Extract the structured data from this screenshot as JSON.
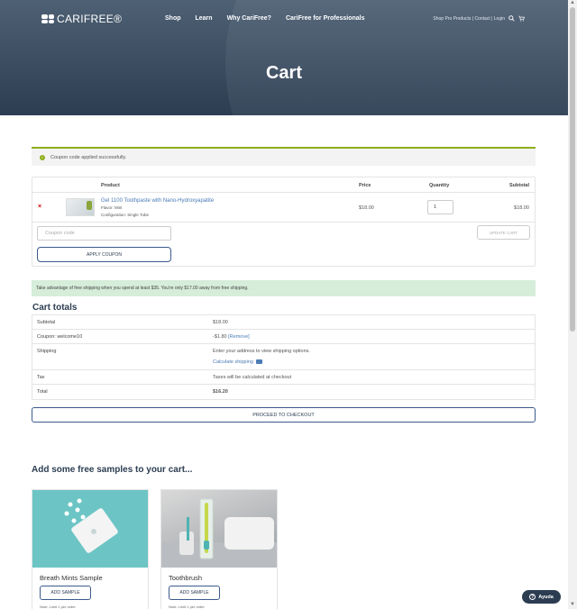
{
  "brand": {
    "logo_text": "CARIFREE®"
  },
  "nav": {
    "items": [
      {
        "label": "Shop"
      },
      {
        "label": "Learn"
      },
      {
        "label": "Why CariFree?"
      },
      {
        "label": "CariFree for Professionals"
      }
    ]
  },
  "utility": {
    "text": "Shop Pro Products | Contact | Login"
  },
  "page": {
    "title": "Cart"
  },
  "notice": {
    "message": "Coupon code applied successfully."
  },
  "cart": {
    "headers": {
      "product": "Product",
      "price": "Price",
      "quantity": "Quantity",
      "subtotal": "Subtotal"
    },
    "items": [
      {
        "name": "Gel 1100 Toothpaste with Nano-Hydroxyapatite",
        "flavor": "Flavor: Mint",
        "configuration": "Configuration: Single Tube",
        "price": "$18.00",
        "quantity": "1",
        "subtotal": "$18.00"
      }
    ],
    "coupon_placeholder": "Coupon code",
    "apply_label": "APPLY COUPON",
    "update_label": "UPDATE CART"
  },
  "shipping_note": "Take advantage of free shipping when you spend at least $35. You're only $17.00 away from free shipping.",
  "totals": {
    "title": "Cart totals",
    "subtotal_label": "Subtotal",
    "subtotal_value": "$18.00",
    "coupon_label": "Coupon: welcome10",
    "coupon_value": "-$1.80",
    "coupon_remove": "[Remove]",
    "shipping_label": "Shipping",
    "shipping_value": "Enter your address to view shipping options.",
    "shipping_link": "Calculate shipping",
    "tax_label": "Tax",
    "tax_value": "Taxes will be calculated at checkout",
    "total_label": "Total",
    "total_value": "$16.20"
  },
  "checkout": {
    "label": "PROCEED TO CHECKOUT"
  },
  "samples": {
    "title": "Add some free samples to your cart...",
    "items": [
      {
        "name": "Breath Mints Sample",
        "button": "ADD SAMPLE",
        "note": "Note: Limit 1 per order"
      },
      {
        "name": "Toothbrush",
        "button": "ADD SAMPLE",
        "note": "Note: Limit 1 per order"
      }
    ]
  },
  "help": {
    "label": "Ayuda"
  },
  "colors": {
    "header": "#2c3d52",
    "accent_green": "#8fae1b",
    "link": "#4b7bb5",
    "notice_green": "#d6edd9"
  }
}
